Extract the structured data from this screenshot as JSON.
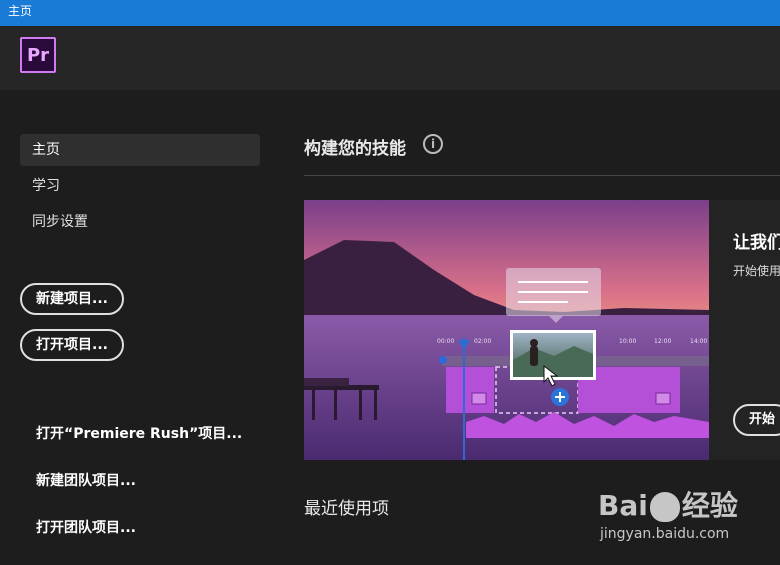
{
  "window": {
    "title": "主页"
  },
  "app": {
    "logo_text": "Pr"
  },
  "sidebar": {
    "nav": [
      {
        "label": "主页",
        "active": true
      },
      {
        "label": "学习",
        "active": false
      },
      {
        "label": "同步设置",
        "active": false
      }
    ],
    "new_project": "新建项目...",
    "open_project": "打开项目...",
    "open_rush": "打开“Premiere Rush”项目...",
    "new_team": "新建团队项目...",
    "open_team": "打开团队项目..."
  },
  "main": {
    "section_title": "构建您的技能",
    "info_icon": "info-icon",
    "banner": {
      "timeline_ticks": [
        "00:00",
        "02:00",
        "10:00",
        "12:00",
        "14:00"
      ]
    },
    "card": {
      "title": "让我们",
      "subtitle": "开始使用",
      "button": "开始"
    },
    "recent_title": "最近使用项"
  },
  "watermark": {
    "brand_left": "Bai",
    "brand_right": "经验",
    "url": "jingyan.baidu.com"
  },
  "colors": {
    "titlebar": "#1a7bd6",
    "accent_purple": "#b44fd8",
    "logo_border": "#d07cf0"
  }
}
